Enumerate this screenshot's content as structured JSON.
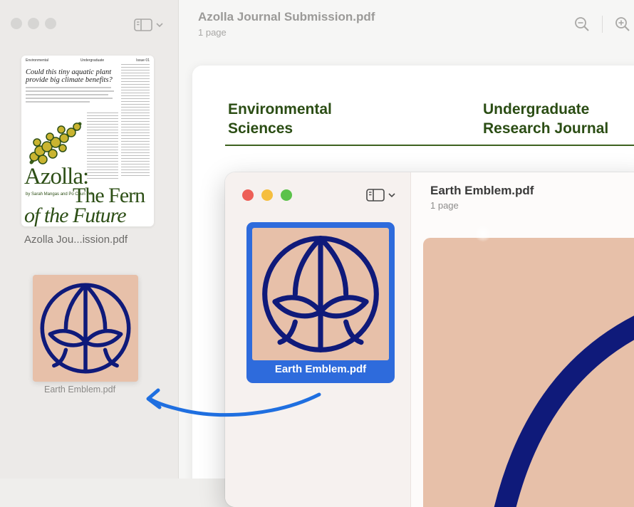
{
  "back_window": {
    "title": "Azolla Journal Submission.pdf",
    "subtitle": "1 page",
    "sidebar": {
      "thumbnail": {
        "header_cols": [
          "Environmental",
          "Undergraduate",
          "Issue 01"
        ],
        "headline": "Could this tiny aquatic plant provide big climate benefits?",
        "title_line1": "Azolla:",
        "title_line2": "The Fern",
        "title_line3": "of the Future",
        "byline": "by Sarah Mangas and Po Chun Yeh"
      },
      "caption": "Azolla Jou...ission.pdf",
      "dragged_item_caption": "Earth Emblem.pdf"
    },
    "document": {
      "left_heading_line1": "Environmental",
      "left_heading_line2": "Sciences",
      "right_heading_line1": "Undergraduate",
      "right_heading_line2": "Research Journal"
    },
    "icons": [
      "sidebar-icon",
      "chevron-down-icon",
      "zoom-out-icon",
      "zoom-in-icon"
    ]
  },
  "front_window": {
    "title": "Earth Emblem.pdf",
    "subtitle": "1 page",
    "selected_thumbnail_label": "Earth Emblem.pdf",
    "icons": [
      "sidebar-icon",
      "chevron-down-icon"
    ]
  },
  "colors": {
    "accent_blue": "#2e6bdc",
    "emblem_navy": "#0f1a7a",
    "emblem_bg": "#e7c0a9",
    "journal_green": "#2b4d14",
    "arrow_blue": "#1f6fe0",
    "traffic_red": "#ed5f57",
    "traffic_yellow": "#f5be3f",
    "traffic_green": "#5bc24a"
  }
}
